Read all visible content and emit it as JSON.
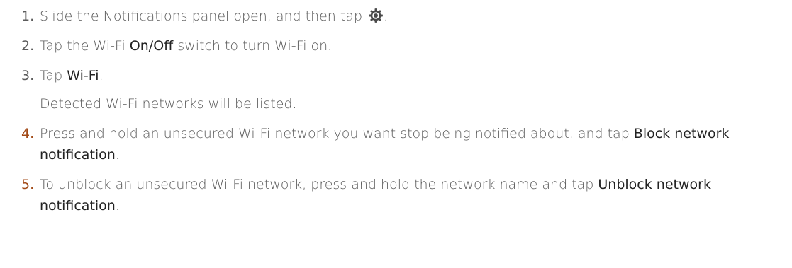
{
  "steps": [
    {
      "number": "1.",
      "text_before": "Slide the Notifications panel open, and then tap ",
      "icon": "settings-gear-icon",
      "text_after": "."
    },
    {
      "number": "2.",
      "text_before": "Tap the Wi-Fi ",
      "term": "On/Off",
      "text_after": " switch to turn Wi-Fi on."
    },
    {
      "number": "3.",
      "text_before": "Tap ",
      "term": "Wi-Fi",
      "text_after": ".",
      "note": "Detected Wi-Fi networks will be listed."
    },
    {
      "number": "4.",
      "text_before": "Press and hold an unsecured Wi-Fi network you want stop being notified about, and tap ",
      "term": "Block network notification",
      "text_after": "."
    },
    {
      "number": "5.",
      "text_before": "To unblock an unsecured Wi-Fi network, press and hold the network name and tap ",
      "term": "Unblock network notification",
      "text_after": "."
    }
  ],
  "colors": {
    "body_text": "#5b5b5b",
    "term_text": "#222222",
    "number_accent": "#a24a17"
  }
}
